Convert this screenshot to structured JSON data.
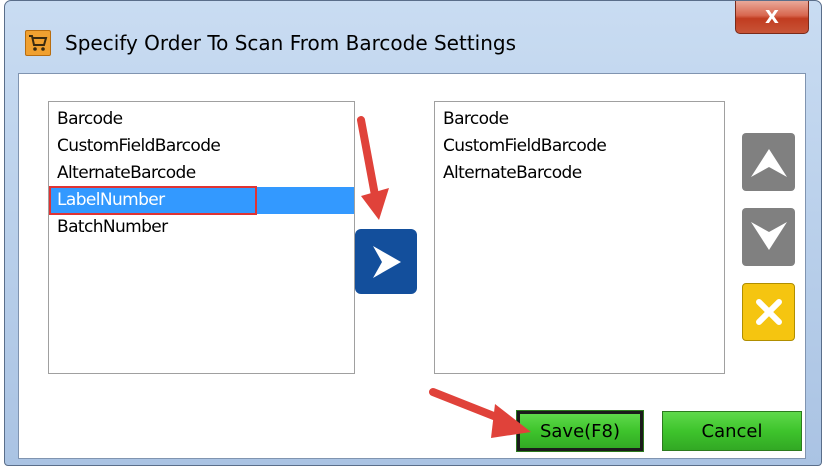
{
  "window": {
    "title": "Specify Order To Scan From Barcode Settings",
    "close_label": "X",
    "app_icon": "cart-icon"
  },
  "left_list": {
    "items": [
      "Barcode",
      "CustomFieldBarcode",
      "AlternateBarcode",
      "LabelNumber",
      "BatchNumber"
    ],
    "selected": "LabelNumber"
  },
  "right_list": {
    "items": [
      "Barcode",
      "CustomFieldBarcode",
      "AlternateBarcode"
    ]
  },
  "controls": {
    "move_right_icon": "chevron-right-icon",
    "move_up_icon": "chevron-up-icon",
    "move_down_icon": "chevron-down-icon",
    "remove_icon": "x-icon"
  },
  "footer": {
    "save_label": "Save(F8)",
    "cancel_label": "Cancel"
  },
  "colors": {
    "selection": "#3399ff",
    "move_button": "#134f9c",
    "green_button": "#3ec42c",
    "remove_button": "#f5c510",
    "annotation_arrow": "#e0423a"
  }
}
